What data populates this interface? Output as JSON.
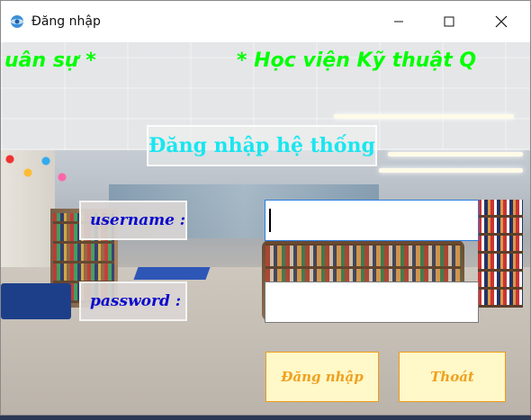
{
  "window": {
    "title": "Đăng nhập",
    "controls": [
      "minimize",
      "maximize",
      "close"
    ]
  },
  "marquee": {
    "left_text": "uân sự *",
    "right_text": "* Học viện Kỹ thuật Q",
    "color": "#00ff00"
  },
  "form": {
    "heading": "Đăng nhập hệ thống",
    "username_label": "username :",
    "password_label": "password :",
    "username_value": "",
    "password_value": ""
  },
  "buttons": {
    "login_label": "Đăng nhập",
    "exit_label": "Thoát"
  },
  "colors": {
    "heading": "#19e6f0",
    "label": "#0a0acc",
    "button_text": "#f0a020",
    "button_bg": "#fff8c8"
  }
}
